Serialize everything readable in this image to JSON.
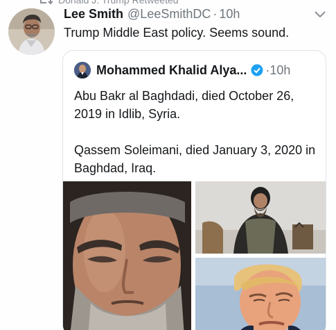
{
  "retweet": {
    "text": "Donald J. Trump Retweeted"
  },
  "tweet": {
    "author_name": "Lee Smith",
    "author_handle": "@LeeSmithDC",
    "separator": "·",
    "time": "10h",
    "text": "Trump Middle East policy. Seems sound."
  },
  "quoted_tweet": {
    "author_name": "Mohammed Khalid Alya...",
    "separator": "·",
    "time": "10h",
    "paragraph_1": "Abu Bakr al Baghdadi, died October 26, 2019 in Idlib, Syria.",
    "paragraph_2": "Qassem Soleimani, died January 3, 2020 in Baghdad, Iraq."
  },
  "colors": {
    "verified": "#1da1f2",
    "text_primary": "#14171a",
    "text_secondary": "#6e767d",
    "card_border": "#dfe3e7"
  },
  "icons": {
    "retweet": "retweet-icon",
    "chevron": "chevron-down-icon",
    "verified": "verified-badge-icon"
  }
}
